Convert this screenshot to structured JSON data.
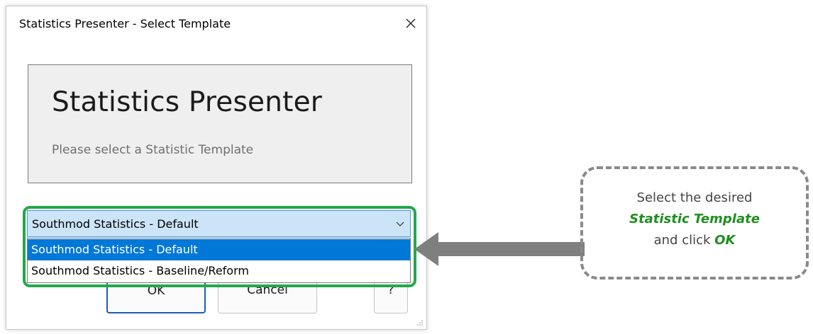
{
  "dialog": {
    "title": "Statistics Presenter - Select Template",
    "close_icon": "close-icon",
    "banner": {
      "title": "Statistics Presenter",
      "subtitle": "Please select a Statistic Template"
    },
    "template_select": {
      "value": "Southmod Statistics - Default",
      "options": [
        "Southmod Statistics - Default",
        "Southmod Statistics - Baseline/Reform"
      ],
      "selected_index": 0
    },
    "buttons": {
      "ok": "OK",
      "cancel": "Cancel",
      "extra": "?"
    }
  },
  "callout": {
    "line1": "Select the desired",
    "line2": "Statistic Template",
    "line3_prefix": "and click ",
    "line3_emphasis": "OK"
  },
  "colors": {
    "highlight": "#22a84a",
    "selection": "#0078d7",
    "emphasis": "#1f8f1f",
    "arrow": "#7f7f7f"
  }
}
